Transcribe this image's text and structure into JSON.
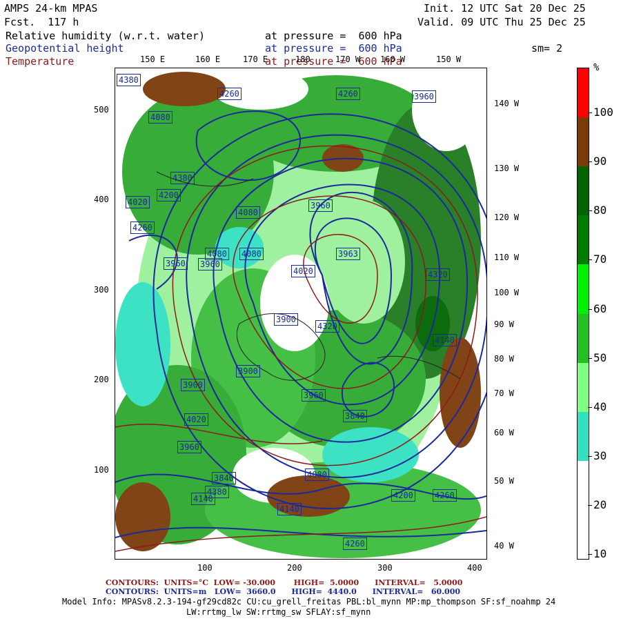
{
  "header": {
    "model_title": "AMPS 24-km MPAS",
    "forecast": "Fcst.  117 h",
    "init": "Init. 12 UTC Sat 20 Dec 25",
    "valid": "Valid. 09 UTC Thu 25 Dec 25",
    "field1_name": "Relative humidity (w.r.t. water)",
    "field1_level": "at pressure =  600 hPa",
    "field2_name": "Geopotential height",
    "field2_level": "at pressure =  600 hPa",
    "field3_name": "Temperature",
    "field3_level": "at pressure =  600 hPa",
    "smoothing": "sm= 2"
  },
  "map": {
    "top_longitudes": [
      "150 E",
      "160 E",
      "170 E",
      "180",
      "170 W",
      "160 W",
      "150 W"
    ],
    "right_longitudes": [
      "140 W",
      "130 W",
      "120 W",
      "110 W",
      "100 W",
      "90 W",
      "80 W",
      "70 W",
      "60 W",
      "50 W",
      "40 W"
    ],
    "y_ticks": [
      "500",
      "400",
      "300",
      "200",
      "100"
    ],
    "x_ticks": [
      "100",
      "200",
      "300",
      "400"
    ],
    "height_labels": [
      "4380",
      "4260",
      "4080",
      "4260",
      "3960",
      "4380",
      "4200",
      "4080",
      "4020",
      "3960",
      "4260",
      "4020",
      "3960",
      "3963",
      "4080",
      "3960",
      "4080",
      "3900",
      "4320",
      "3900",
      "3840",
      "3900",
      "3960",
      "4020",
      "4080",
      "3960",
      "3840",
      "4140",
      "4260",
      "4380",
      "4140",
      "4200",
      "4320",
      "4260",
      "4140"
    ]
  },
  "colorbar": {
    "unit": "%",
    "labels": [
      "100",
      "90",
      "80",
      "70",
      "60",
      "50",
      "40",
      "30",
      "20",
      "10"
    ],
    "colors": [
      "#ff0000",
      "#7a3a0a",
      "#006400",
      "#007a00",
      "#00ee00",
      "#22c022",
      "#80ff80",
      "#33e0c0",
      "#ffffff",
      "#ffffff"
    ]
  },
  "footer": {
    "temp_contours": "CONTOURS:  UNITS=°C  LOW= -30.000       HIGH=  5.0000      INTERVAL=   5.0000",
    "height_contours": "CONTOURS:  UNITS=m   LOW=  3660.0      HIGH=  4440.0      INTERVAL=   60.000",
    "model_info_1": "Model Info: MPASv8.2.3-194-gf29cd82c CU:cu_grell_freitas PBL:bl_mynn MP:mp_thompson SF:sf_noahmp 24",
    "model_info_2": "LW:rrtmg_lw SW:rrtmg_sw SFLAY:sf_mynn"
  }
}
